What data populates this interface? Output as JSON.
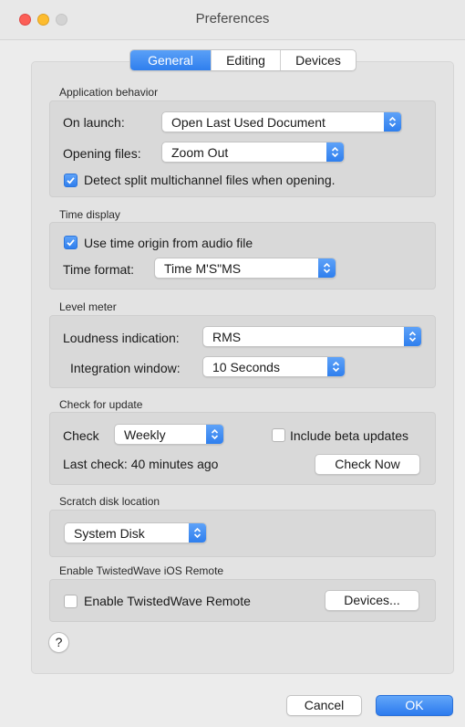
{
  "window": {
    "title": "Preferences"
  },
  "tabs": [
    {
      "label": "General",
      "active": true
    },
    {
      "label": "Editing",
      "active": false
    },
    {
      "label": "Devices",
      "active": false
    }
  ],
  "application_behavior": {
    "title": "Application behavior",
    "on_launch_label": "On launch:",
    "on_launch_value": "Open Last Used Document",
    "opening_files_label": "Opening files:",
    "opening_files_value": "Zoom Out",
    "detect_split_label": "Detect split multichannel files when opening.",
    "detect_split_checked": true
  },
  "time_display": {
    "title": "Time display",
    "use_origin_label": "Use time origin from audio file",
    "use_origin_checked": true,
    "time_format_label": "Time format:",
    "time_format_value": "Time M'S\"MS"
  },
  "level_meter": {
    "title": "Level meter",
    "loudness_label": "Loudness indication:",
    "loudness_value": "RMS",
    "integration_label": "Integration window:",
    "integration_value": "10 Seconds"
  },
  "check_update": {
    "title": "Check for update",
    "check_label": "Check",
    "check_value": "Weekly",
    "beta_label": "Include beta updates",
    "beta_checked": false,
    "last_check": "Last check: 40 minutes ago",
    "check_now_label": "Check Now"
  },
  "scratch_disk": {
    "title": "Scratch disk location",
    "value": "System Disk"
  },
  "ios_remote": {
    "title": "Enable TwistedWave iOS Remote",
    "enable_label": "Enable TwistedWave Remote",
    "enable_checked": false,
    "devices_label": "Devices..."
  },
  "help_label": "?",
  "footer": {
    "cancel_label": "Cancel",
    "ok_label": "OK"
  },
  "colors": {
    "accent": "#2f7fee",
    "panel": "#e3e3e3",
    "group": "#d9d9d9"
  }
}
